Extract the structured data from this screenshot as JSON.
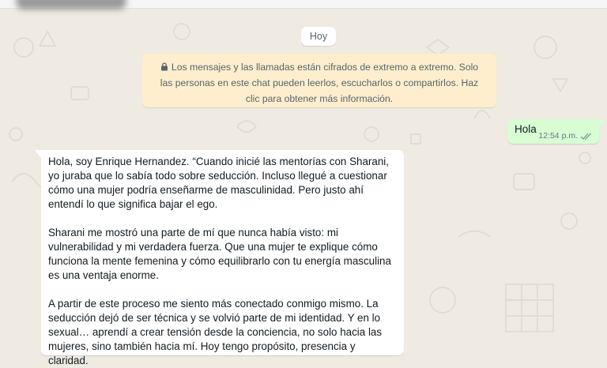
{
  "colors": {
    "chat_background": "#efeae2",
    "encryption_notice_bg": "#ffeecd",
    "outgoing_bubble_bg": "#d9fdd3",
    "incoming_bubble_bg": "#ffffff",
    "read_ticks": "#8696a0"
  },
  "date_separator": "Hoy",
  "encryption_notice": {
    "icon": "lock-icon",
    "text": "Los mensajes y las llamadas están cifrados de extremo a extremo. Solo las personas en este chat pueden leerlos, escucharlos o compartirlos. Haz clic para obtener más información."
  },
  "messages": [
    {
      "direction": "outgoing",
      "text": "Hola",
      "time": "12:54 p.m.",
      "status_icon": "double-check-icon"
    },
    {
      "direction": "incoming",
      "paragraphs": [
        "Hola, soy Enrique Hernandez. “Cuando inicié las mentorías con Sharani, yo juraba que lo sabía todo sobre seducción. Incluso llegué a cuestionar cómo una mujer podría enseñarme de masculinidad. Pero justo ahí entendí lo que significa bajar el ego.",
        "Sharani me mostró una parte de mí que nunca había visto: mi vulnerabilidad y mi verdadera fuerza. Que una mujer te explique cómo funciona la mente femenina y cómo equilibrarlo con tu energía masculina es una ventaja enorme.",
        "A partir de este proceso me siento más conectado conmigo mismo. La seducción dejó de ser técnica y se volvió parte de mi identidad. Y en lo sexual… aprendí a crear tensión desde la conciencia, no solo hacia las mujeres, sino también hacia mí. Hoy tengo propósito, presencia y claridad."
      ]
    }
  ]
}
